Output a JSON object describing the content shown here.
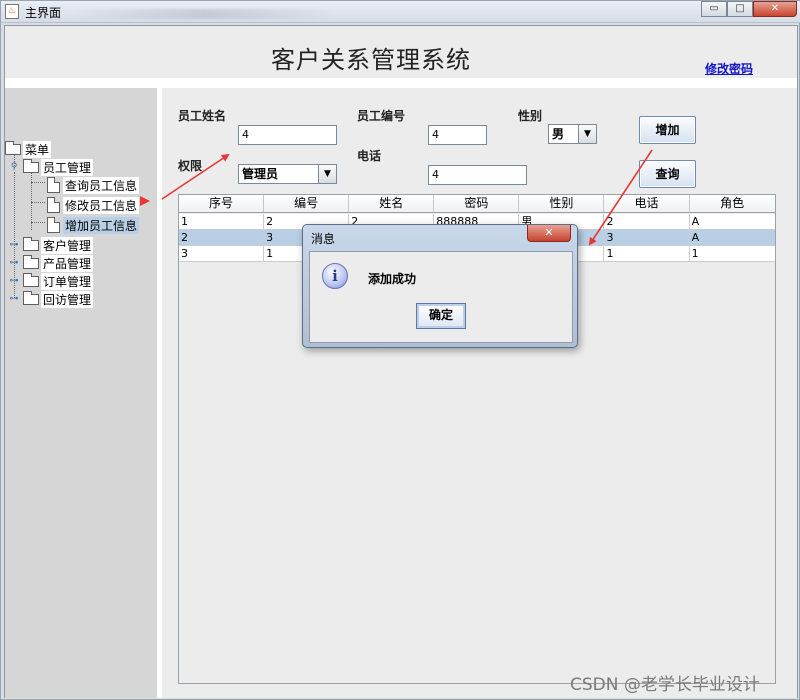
{
  "window": {
    "title": "主界面",
    "close_glyph": "✕",
    "min_glyph": "▭",
    "max_glyph": "□",
    "icon": "java-cup-icon"
  },
  "header": {
    "title": "客户关系管理系统",
    "change_password": "修改密码"
  },
  "tree": {
    "root": "菜单",
    "groups": [
      {
        "label": "员工管理",
        "expanded": true,
        "children": [
          "查询员工信息",
          "修改员工信息",
          "增加员工信息"
        ]
      },
      {
        "label": "客户管理",
        "expanded": false
      },
      {
        "label": "产品管理",
        "expanded": false
      },
      {
        "label": "订单管理",
        "expanded": false
      },
      {
        "label": "回访管理",
        "expanded": false
      }
    ],
    "selected": "增加员工信息"
  },
  "form": {
    "name_label": "员工姓名",
    "name_value": "4",
    "id_label": "员工编号",
    "id_value": "4",
    "gender_label": "性别",
    "gender_value": "男",
    "role_label": "权限",
    "role_value": "管理员",
    "phone_label": "电话",
    "phone_value": "4",
    "add_button": "增加",
    "query_button": "查询"
  },
  "table": {
    "columns": [
      "序号",
      "编号",
      "姓名",
      "密码",
      "性别",
      "电话",
      "角色"
    ],
    "rows": [
      [
        "1",
        "2",
        "2",
        "888888",
        "男",
        "2",
        "A"
      ],
      [
        "2",
        "3",
        "",
        "",
        "",
        "3",
        "A"
      ],
      [
        "3",
        "1",
        "",
        "",
        "",
        "1",
        "1"
      ]
    ],
    "selected_row": 1
  },
  "dialog": {
    "title": "消息",
    "close_glyph": "✕",
    "message": "添加成功",
    "ok": "确定",
    "icon": "info-icon"
  },
  "watermark": "CSDN @老学长毕业设计",
  "colors": {
    "annotation_arrow": "#e53935",
    "selection": "#b8cfe5",
    "link": "#1515c8"
  }
}
